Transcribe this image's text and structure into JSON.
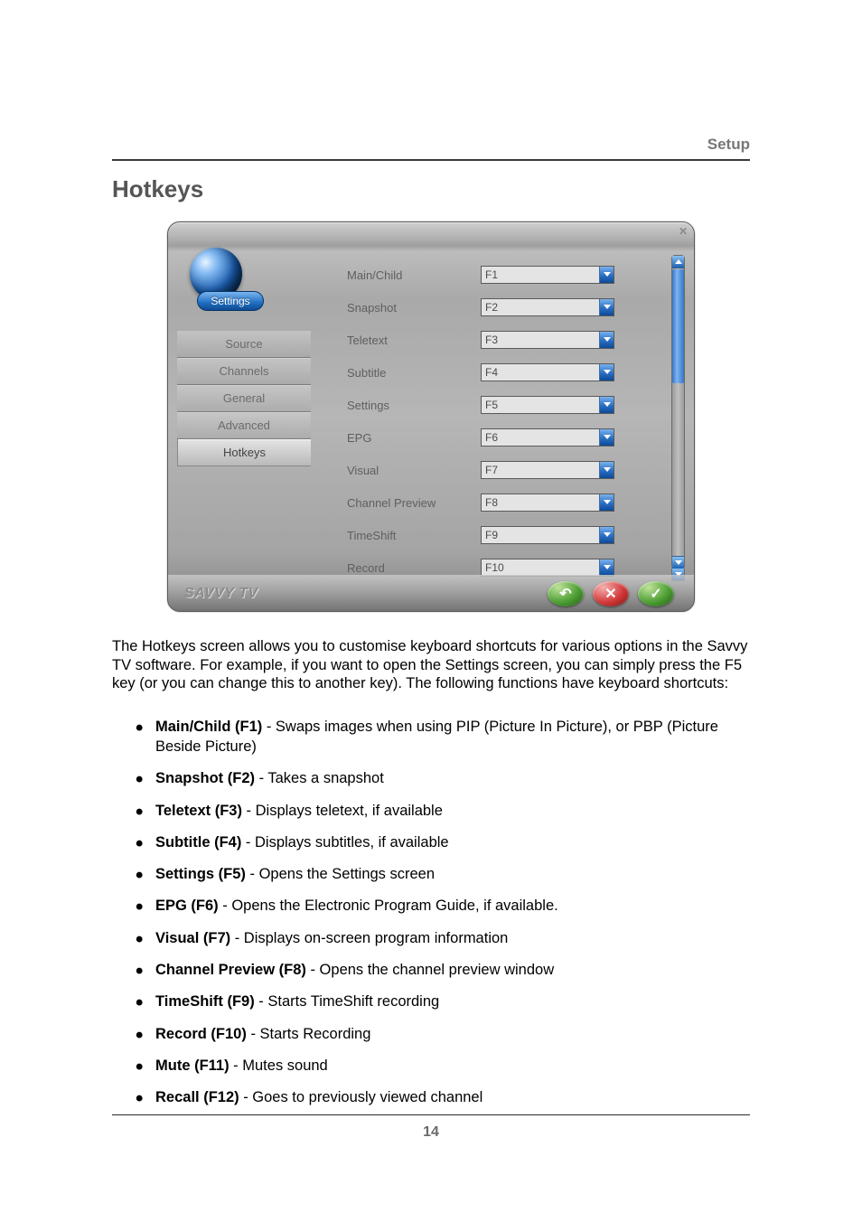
{
  "header": {
    "section": "Setup"
  },
  "title": "Hotkeys",
  "window": {
    "settings_label": "Settings",
    "brand": "SAVVY TV",
    "nav": [
      {
        "label": "Source",
        "active": false
      },
      {
        "label": "Channels",
        "active": false
      },
      {
        "label": "General",
        "active": false
      },
      {
        "label": "Advanced",
        "active": false
      },
      {
        "label": "Hotkeys",
        "active": true
      }
    ],
    "rows": [
      {
        "label": "Main/Child",
        "value": "F1"
      },
      {
        "label": "Snapshot",
        "value": "F2"
      },
      {
        "label": "Teletext",
        "value": "F3"
      },
      {
        "label": "Subtitle",
        "value": "F4"
      },
      {
        "label": "Settings",
        "value": "F5"
      },
      {
        "label": "EPG",
        "value": "F6"
      },
      {
        "label": "Visual",
        "value": "F7"
      },
      {
        "label": "Channel Preview",
        "value": "F8"
      },
      {
        "label": "TimeShift",
        "value": "F9"
      },
      {
        "label": "Record",
        "value": "F10"
      }
    ],
    "buttons": {
      "undo": "↶",
      "cancel": "✕",
      "ok": "✓"
    }
  },
  "intro": "The Hotkeys screen allows you to customise keyboard shortcuts for various options in the Savvy TV software. For example, if you want to open the Settings screen, you can simply press the F5 key (or you can change this to another key). The following functions have keyboard shortcuts:",
  "list": [
    {
      "b": "Main/Child (F1)",
      "t": " - Swaps images when using PIP (Picture In Picture), or PBP (Picture Beside Picture)"
    },
    {
      "b": "Snapshot (F2)",
      "t": " - Takes a snapshot"
    },
    {
      "b": "Teletext (F3)",
      "t": " - Displays teletext, if available"
    },
    {
      "b": "Subtitle (F4)",
      "t": " - Displays subtitles, if available"
    },
    {
      "b": "Settings (F5)",
      "t": " - Opens the Settings screen"
    },
    {
      "b": "EPG (F6)",
      "t": " - Opens the Electronic Program Guide, if available."
    },
    {
      "b": "Visual (F7)",
      "t": " - Displays on-screen program information"
    },
    {
      "b": "Channel Preview (F8)",
      "t": " - Opens the channel preview window"
    },
    {
      "b": "TimeShift (F9)",
      "t": " - Starts TimeShift recording"
    },
    {
      "b": "Record (F10)",
      "t": " - Starts Recording"
    },
    {
      "b": "Mute (F11)",
      "t": " - Mutes sound"
    },
    {
      "b": "Recall (F12)",
      "t": " - Goes to previously viewed channel"
    }
  ],
  "page_number": "14"
}
